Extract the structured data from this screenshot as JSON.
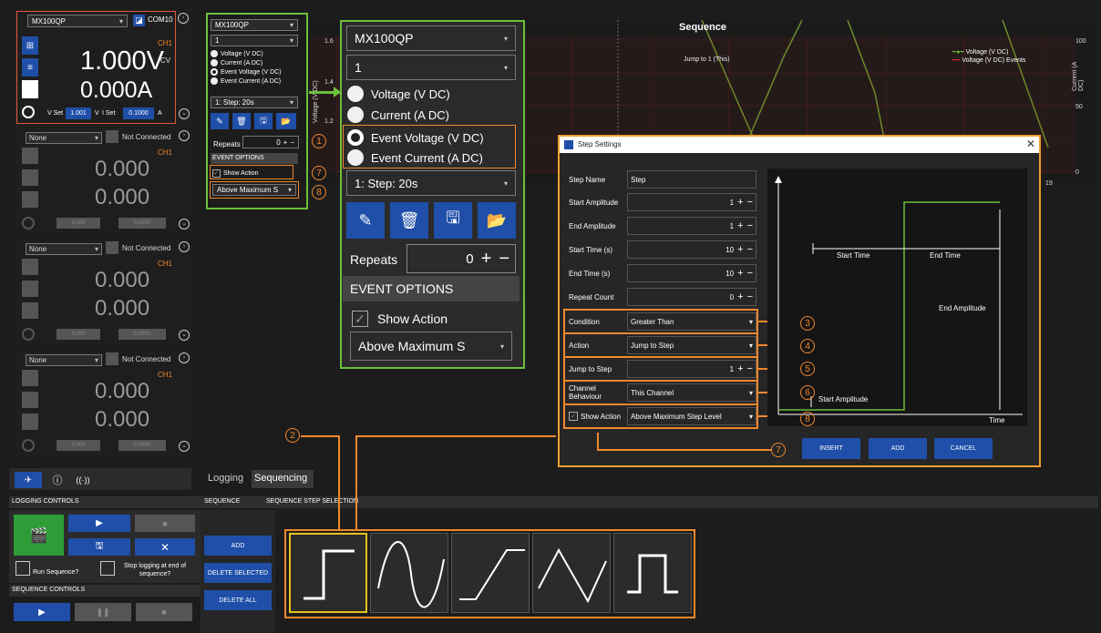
{
  "colors": {
    "accent": "#1f4fa8",
    "callout": "#f0882c",
    "highlight": "#6cbf3c",
    "trace": "#6a8f2a"
  },
  "channel1": {
    "device": "MX100QP",
    "com": "COM10",
    "ch": "CH1",
    "voltage": "1.000V",
    "mode": "CV",
    "current": "0.000A",
    "vset_label": "V Set",
    "vset": "1.001",
    "vunit": "V",
    "iset_label": "I Set",
    "iset": "0.1000",
    "iunit": "A"
  },
  "channels": [
    {
      "select": "None",
      "status": "Not Connected",
      "ch": "CH1",
      "v": "0.000",
      "i": "0.000",
      "set1": "0.000",
      "set2": "0.0000"
    },
    {
      "select": "None",
      "status": "Not Connected",
      "ch": "CH1",
      "v": "0.000",
      "i": "0.000",
      "set1": "0.000",
      "set2": "0.0000"
    },
    {
      "select": "None",
      "status": "Not Connected",
      "ch": "CH1",
      "v": "0.000",
      "i": "0.000",
      "set1": "0.000",
      "set2": "0.0000"
    }
  ],
  "small_panel": {
    "device": "MX100QP",
    "channel": "1",
    "opt1": "Voltage (V DC)",
    "opt2": "Current (A DC)",
    "opt3": "Event Voltage (V DC)",
    "opt4": "Event Current (A DC)",
    "step": "1: Step: 20s",
    "repeats_label": "Repeats",
    "repeats": "0",
    "event_options": "EVENT OPTIONS",
    "show_action": "Show Action",
    "action_select": "Above Maximum S"
  },
  "zoom_panel": {
    "device": "MX100QP",
    "channel": "1",
    "opt1": "Voltage (V DC)",
    "opt2": "Current (A DC)",
    "opt3": "Event Voltage (V DC)",
    "opt4": "Event Current (A DC)",
    "step": "1: Step: 20s",
    "repeats_label": "Repeats",
    "repeats": "0",
    "event_options": "EVENT OPTIONS",
    "show_action": "Show Action",
    "action_select": "Above Maximum S"
  },
  "chart": {
    "title": "Sequence",
    "annotation": "Jump to 1 (This)",
    "ylabel_left": "Voltage (V DC)",
    "ylabel_right": "Current (A DC)",
    "legend1": "Voltage (V DC)",
    "legend2": "Voltage (V DC) Events",
    "yticks_left": [
      "1.6",
      "1.4",
      "1.2"
    ],
    "yticks_right": [
      "100",
      "50",
      "0"
    ],
    "xtick": "19"
  },
  "step_settings": {
    "title": "Step Settings",
    "rows": [
      {
        "label": "Step Name",
        "value": "Step"
      },
      {
        "label": "Start Amplitude",
        "value": "1"
      },
      {
        "label": "End Amplitude",
        "value": "1"
      },
      {
        "label": "Start Time (s)",
        "value": "10"
      },
      {
        "label": "End Time (s)",
        "value": "10"
      },
      {
        "label": "Repeat Count",
        "value": "0"
      },
      {
        "label": "Condition",
        "value": "Greater Than"
      },
      {
        "label": "Action",
        "value": "Jump to Step"
      },
      {
        "label": "Jump to Step",
        "value": "1"
      },
      {
        "label": "Channel Behaviour",
        "value": "This Channel"
      },
      {
        "label": "Show Action",
        "value": "Above Maximum Step Level"
      }
    ],
    "diagram": {
      "start_time": "Start Time",
      "end_time": "End Time",
      "end_amplitude": "End Amplitude",
      "start_amplitude": "Start Amplitude",
      "time": "Time"
    },
    "insert": "INSERT",
    "add": "ADD",
    "cancel": "CANCEL"
  },
  "tabs": {
    "logging": "Logging",
    "sequencing": "Sequencing"
  },
  "logging_controls": {
    "title": "LOGGING CONTROLS",
    "run_seq": "Run Sequence?",
    "stop_log": "Stop logging at end of sequence?"
  },
  "sequence_controls": {
    "title": "SEQUENCE CONTROLS"
  },
  "sequence": {
    "title": "SEQUENCE",
    "add": "ADD",
    "delete_selected": "DELETE SELECTED",
    "delete_all": "DELETE ALL"
  },
  "step_selection": {
    "title": "SEQUENCE STEP SELECTION"
  },
  "callouts": [
    "1",
    "2",
    "3",
    "4",
    "5",
    "6",
    "7",
    "8",
    "7",
    "8"
  ]
}
